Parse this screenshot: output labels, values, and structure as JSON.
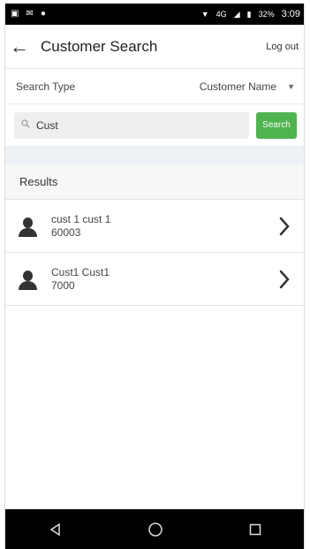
{
  "status_bar": {
    "left_icons": [
      "screen-icon",
      "notification-icon",
      "android-icon"
    ],
    "right_icons": [
      "wifi-icon",
      "signal-icon",
      "battery-icon"
    ],
    "network": "4G",
    "battery": "32%",
    "time": "3:09"
  },
  "header": {
    "title": "Customer Search",
    "logout_label": "Log out"
  },
  "search_type": {
    "label": "Search Type",
    "value": "Customer Name"
  },
  "search": {
    "value": "Cust",
    "button_label": "Search"
  },
  "results": {
    "title": "Results",
    "items": [
      {
        "name": "cust 1 cust 1",
        "id": "60003"
      },
      {
        "name": "Cust1 Cust1",
        "id": "7000"
      }
    ]
  },
  "colors": {
    "accent": "#4fb34f",
    "bars": "#000000"
  }
}
